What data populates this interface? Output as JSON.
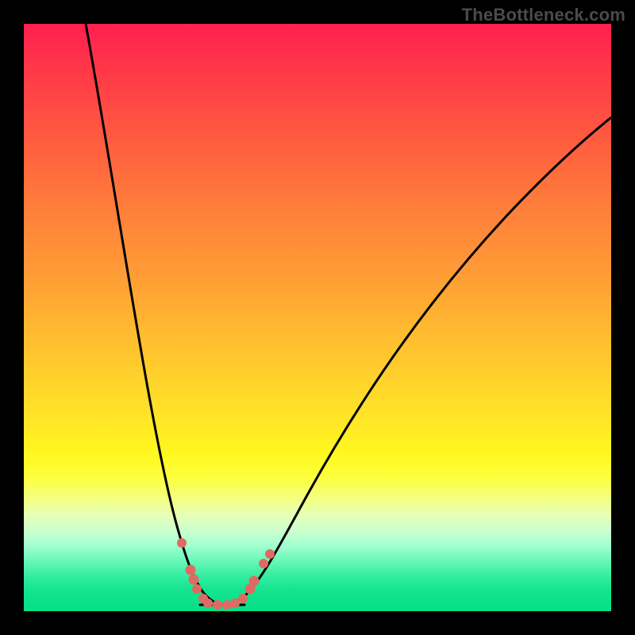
{
  "watermark": "TheBottleneck.com",
  "chart_data": {
    "type": "line",
    "title": "",
    "xlabel": "",
    "ylabel": "",
    "xlim": [
      0,
      100
    ],
    "ylim": [
      0,
      100
    ],
    "legend": false,
    "description": "Bottleneck curve: two asymmetric branches meeting at a minimum near x≈33 on a red→yellow→green vertical gradient. Small pink markers cluster near the valley.",
    "series": [
      {
        "name": "left-branch",
        "x": [
          10,
          15,
          20,
          25,
          28,
          31,
          33
        ],
        "values": [
          100,
          70,
          40,
          18,
          8,
          2,
          0
        ]
      },
      {
        "name": "right-branch",
        "x": [
          33,
          36,
          40,
          48,
          60,
          75,
          90,
          100
        ],
        "values": [
          0,
          3,
          9,
          22,
          40,
          60,
          77,
          85
        ]
      }
    ],
    "scatter": {
      "name": "markers",
      "x": [
        27,
        28.5,
        29,
        29.5,
        30.5,
        31.2,
        33,
        34.5,
        36,
        37,
        38.5,
        39.2,
        41,
        42
      ],
      "values": [
        11.5,
        7,
        5.5,
        4,
        2.5,
        1.5,
        0,
        0,
        1,
        2,
        4,
        5.5,
        8.5,
        10
      ]
    },
    "background_gradient": {
      "direction": "vertical",
      "stops": [
        {
          "pos": 0.0,
          "color": "#ff1f4e"
        },
        {
          "pos": 0.3,
          "color": "#ff7a3b"
        },
        {
          "pos": 0.66,
          "color": "#ffe228"
        },
        {
          "pos": 0.77,
          "color": "#fdff3a"
        },
        {
          "pos": 0.89,
          "color": "#9effcf"
        },
        {
          "pos": 1.0,
          "color": "#05df86"
        }
      ]
    }
  }
}
